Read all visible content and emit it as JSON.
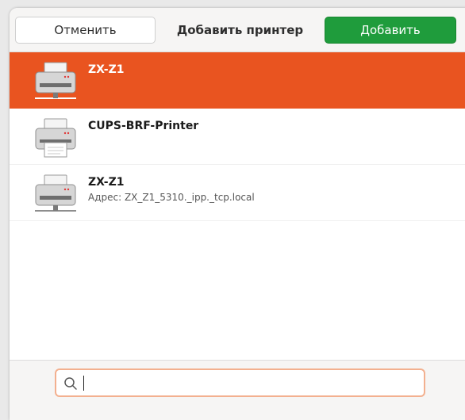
{
  "header": {
    "cancel_label": "Отменить",
    "title": "Добавить принтер",
    "add_label": "Добавить"
  },
  "printers": [
    {
      "name": "ZX-Z1",
      "address": "",
      "icon": "network-printer-icon",
      "selected": true
    },
    {
      "name": "CUPS-BRF-Printer",
      "address": "",
      "icon": "braille-printer-icon",
      "selected": false
    },
    {
      "name": "ZX-Z1",
      "address": "Адрес: ZX_Z1_5310._ipp._tcp.local",
      "icon": "network-printer-icon",
      "selected": false
    }
  ],
  "search": {
    "value": "",
    "placeholder": "",
    "icon": "search-icon"
  },
  "colors": {
    "accent": "#e95420",
    "add_button": "#1f9c3c",
    "search_focus_border": "#f3b08f"
  }
}
